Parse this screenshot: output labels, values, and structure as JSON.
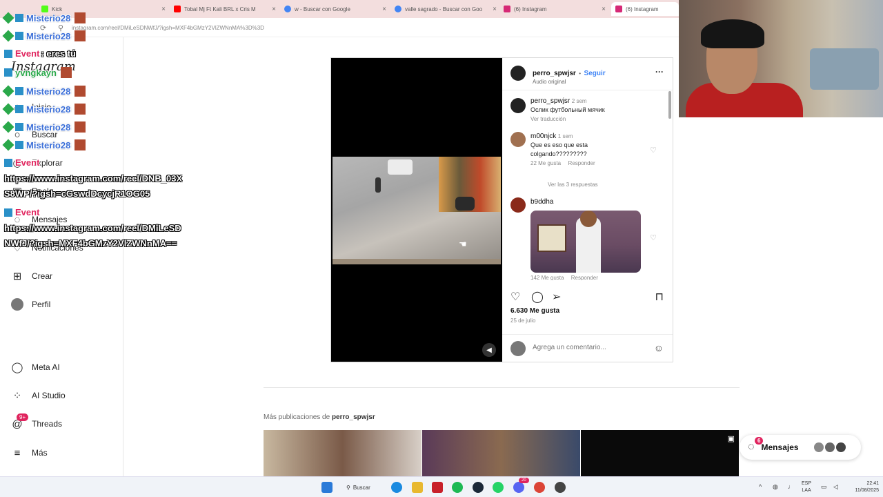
{
  "browser": {
    "tabs": [
      {
        "title": "Kick",
        "color": "#53fc18"
      },
      {
        "title": "Tobal Mj Ft Kali BRL x Cris M",
        "color": "#ff0000"
      },
      {
        "title": "w - Buscar con Google",
        "color": "#4285f4"
      },
      {
        "title": "valle sagrado - Buscar con Goo",
        "color": "#4285f4"
      },
      {
        "title": "(6) Instagram",
        "color": "#d62976"
      },
      {
        "title": "(6) Instagram",
        "color": "#d62976"
      }
    ],
    "url": "instagram.com/reel/DMiLeSDNWfJ/?igsh=MXF4bGMzY2VlZWNnMA%3D%3D"
  },
  "sidebar": {
    "logo": "Instagram",
    "items": [
      {
        "label": "Inicio",
        "icon": "home-icon"
      },
      {
        "label": "Buscar",
        "icon": "search-icon"
      },
      {
        "label": "Explorar",
        "icon": "compass-icon"
      },
      {
        "label": "Reels",
        "icon": "reels-icon"
      },
      {
        "label": "Mensajes",
        "icon": "messenger-icon"
      },
      {
        "label": "Notificaciones",
        "icon": "heart-icon"
      },
      {
        "label": "Crear",
        "icon": "plus-icon"
      },
      {
        "label": "Perfil",
        "icon": "avatar"
      },
      {
        "label": "Meta AI",
        "icon": "meta-ai-icon"
      },
      {
        "label": "AI Studio",
        "icon": "ai-studio-icon"
      },
      {
        "label": "Threads",
        "icon": "threads-icon",
        "badge": "9+"
      },
      {
        "label": "Más",
        "icon": "menu-icon"
      }
    ]
  },
  "post": {
    "author": "perro_spwjsr",
    "follow": "Seguir",
    "separator": "•",
    "audio": "Audio original",
    "caption": {
      "user": "perro_spwjsr",
      "time": "2 sem",
      "text": "Ослик футбольный мячик",
      "translate": "Ver traducción"
    },
    "comments": [
      {
        "user": "m00njck",
        "time": "1 sem",
        "text": "Que es eso que esta colgando?????????",
        "likes": "22 Me gusta",
        "reply": "Responder",
        "replies": "Ver las 3 respuestas"
      },
      {
        "user": "b9ddha",
        "likes": "142 Me gusta",
        "reply": "Responder"
      }
    ],
    "likes": "6.630 Me gusta",
    "date": "25 de julio",
    "add_comment_placeholder": "Agrega un comentario..."
  },
  "more_posts": {
    "prefix": "Más publicaciones de",
    "user": "perro_spwjsr"
  },
  "messages_pill": {
    "label": "Mensajes",
    "badge": "6"
  },
  "chat_overlay": {
    "users": [
      "Misterio28",
      "Misterio28",
      "Misterio28",
      "Misterio28",
      "Misterio28",
      "Misterio28"
    ],
    "event_label": "Event",
    "event_text": ": eres tú",
    "user2": "yvngkayn",
    "link1": "https://www.instagram.com/reel/DNB_03X S8WP/?igsh=cGswdDcycjR1OG05",
    "link2": "https://www.instagram.com/reel/DMiLeSD NWfJ/?igsh=MXF4bGMzY2VlZWNnMA=="
  },
  "taskbar": {
    "search": "Buscar",
    "lang": "ESP",
    "lang2": "LAA",
    "time": "22:41",
    "date": "11/08/2025",
    "badge": "20"
  }
}
